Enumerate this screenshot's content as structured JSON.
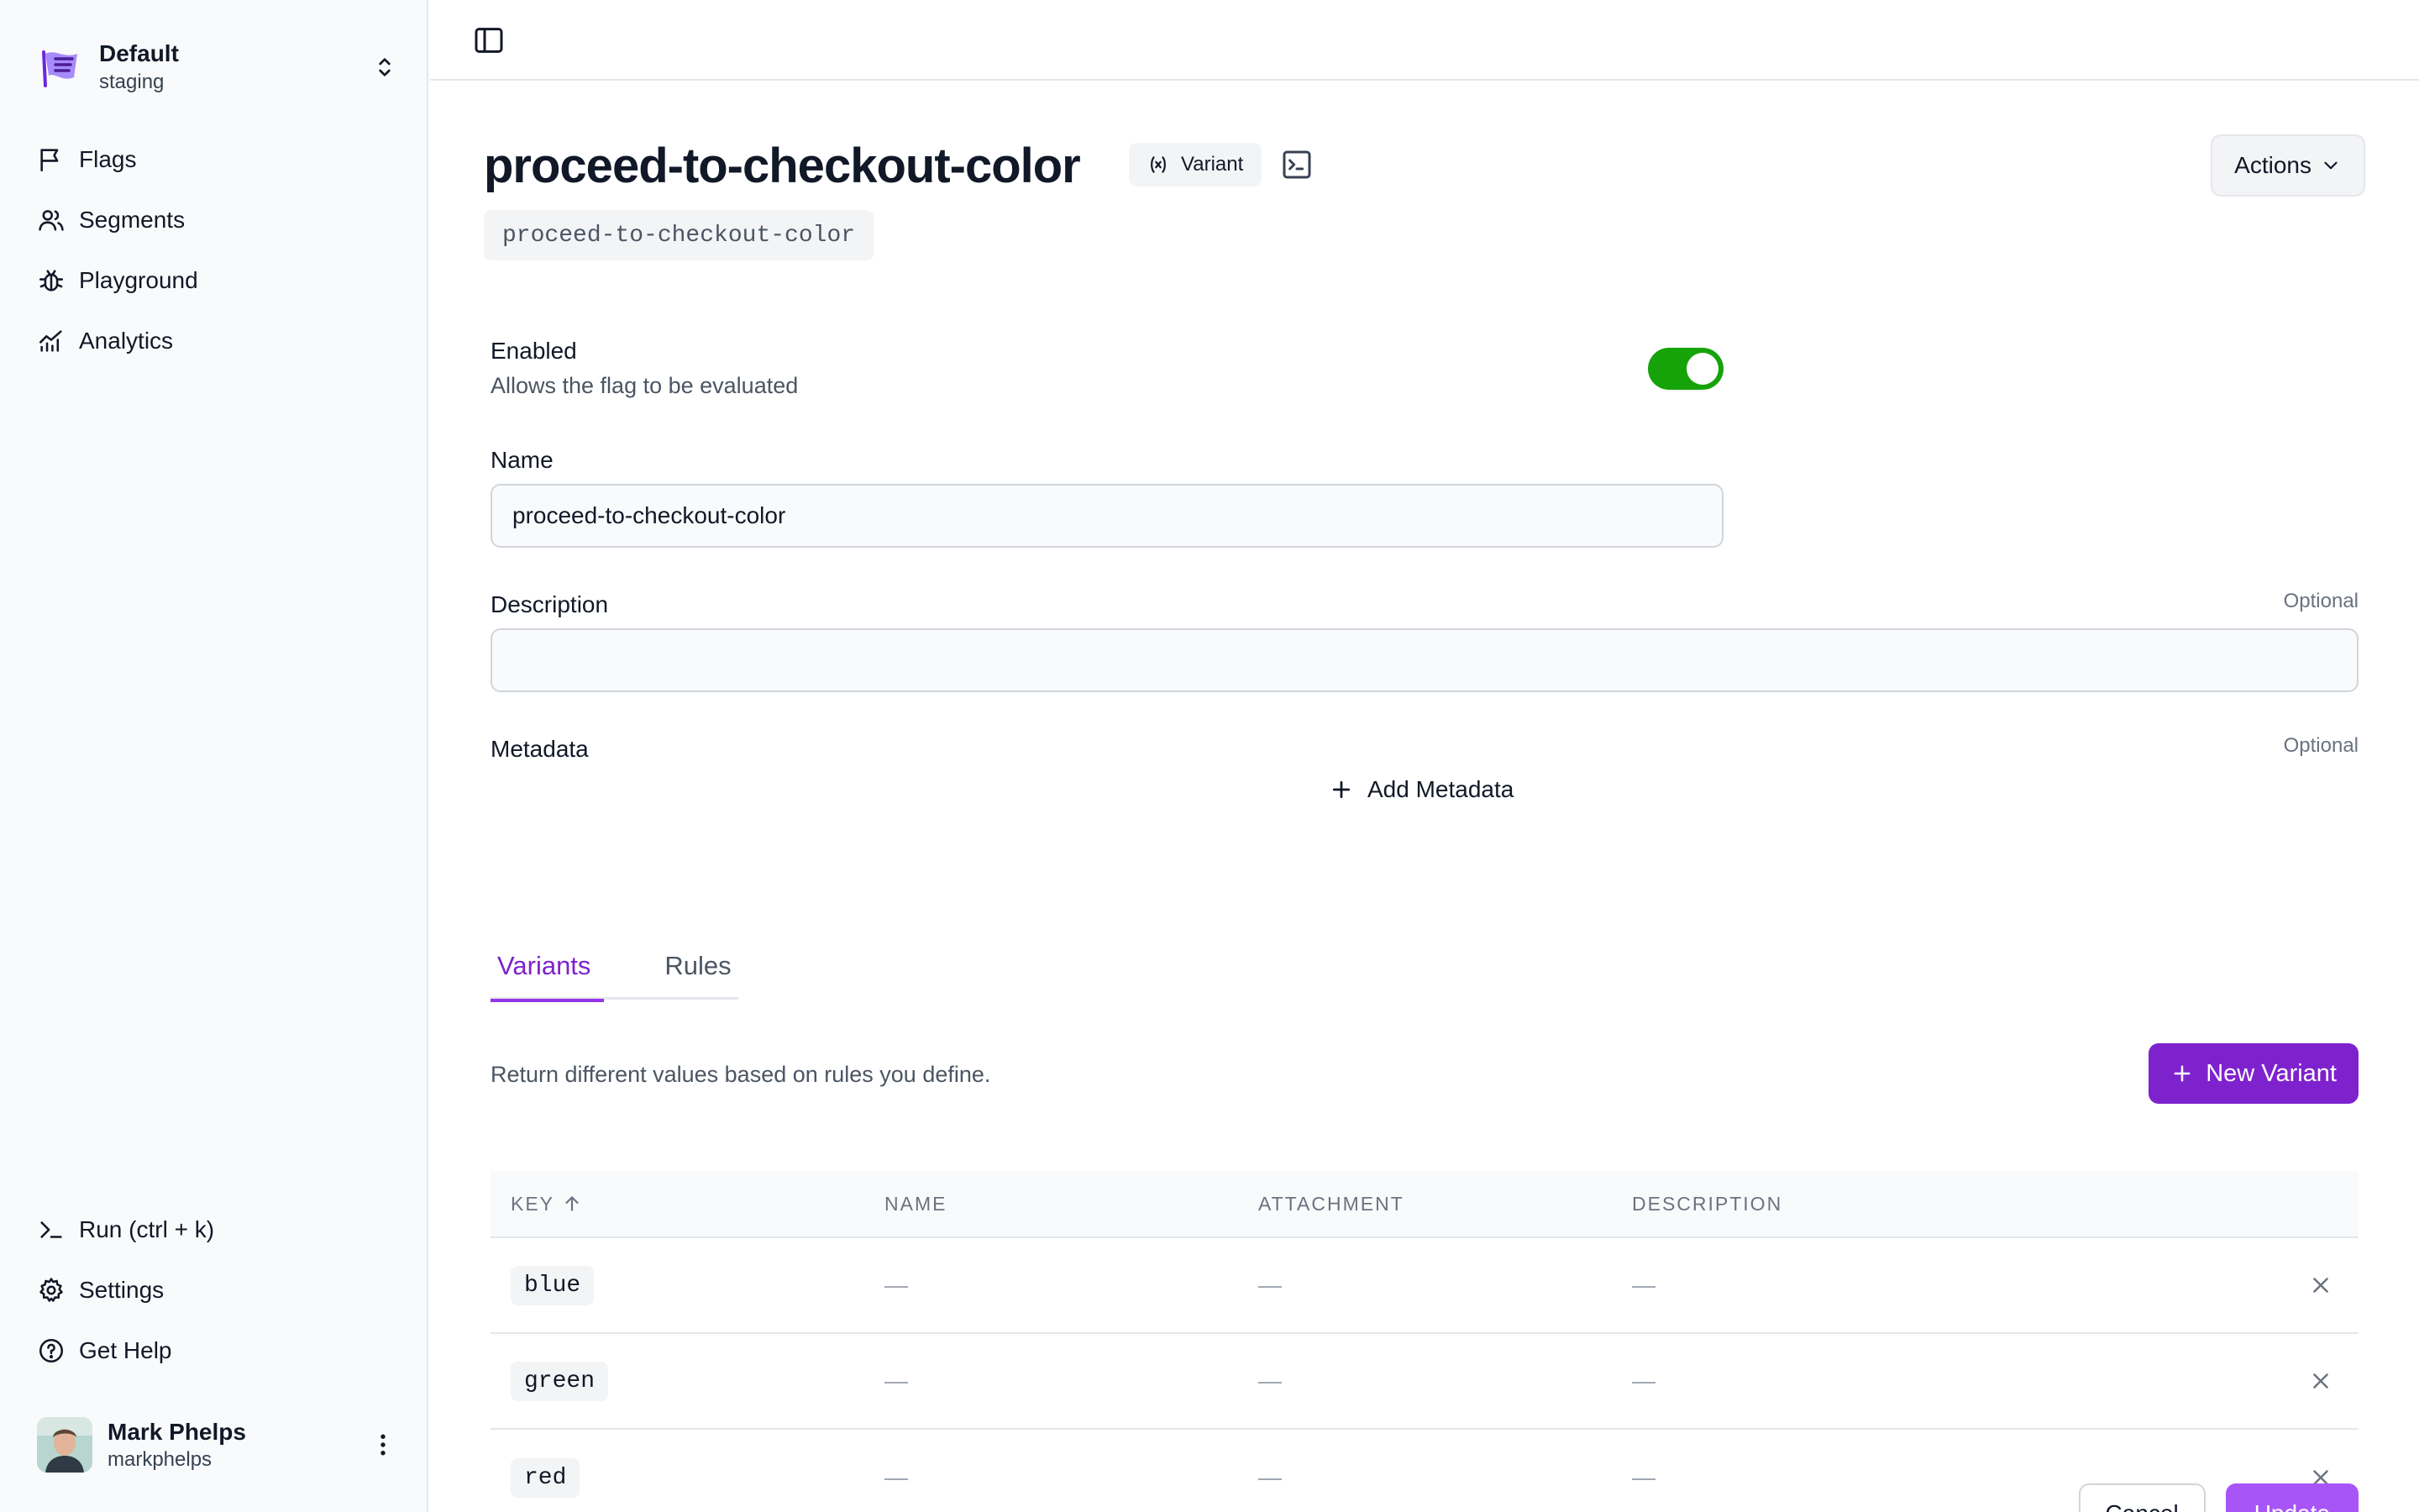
{
  "namespace": {
    "name": "Default",
    "environment": "staging"
  },
  "sidebar": {
    "items": [
      {
        "label": "Flags",
        "icon": "flag-icon"
      },
      {
        "label": "Segments",
        "icon": "users-icon"
      },
      {
        "label": "Playground",
        "icon": "bug-icon"
      },
      {
        "label": "Analytics",
        "icon": "chart-icon"
      }
    ],
    "bottom_items": [
      {
        "label": "Run (ctrl + k)",
        "icon": "terminal-icon"
      },
      {
        "label": "Settings",
        "icon": "gear-icon"
      },
      {
        "label": "Get Help",
        "icon": "help-icon"
      }
    ],
    "user": {
      "name": "Mark Phelps",
      "handle": "markphelps"
    }
  },
  "flag": {
    "title": "proceed-to-checkout-color",
    "type_badge": "Variant",
    "key": "proceed-to-checkout-color",
    "actions_label": "Actions"
  },
  "form": {
    "enabled_label": "Enabled",
    "enabled_help": "Allows the flag to be evaluated",
    "enabled": true,
    "name_label": "Name",
    "name_value": "proceed-to-checkout-color",
    "description_label": "Description",
    "description_optional": "Optional",
    "description_value": "",
    "metadata_label": "Metadata",
    "metadata_optional": "Optional",
    "add_metadata_label": "Add Metadata"
  },
  "tabs": [
    {
      "label": "Variants",
      "active": true
    },
    {
      "label": "Rules",
      "active": false
    }
  ],
  "variants": {
    "description": "Return different values based on rules you define.",
    "new_button": "New Variant",
    "columns": [
      "KEY",
      "NAME",
      "ATTACHMENT",
      "DESCRIPTION"
    ],
    "rows": [
      {
        "key": "blue",
        "name": "—",
        "attachment": "—",
        "description": "—"
      },
      {
        "key": "green",
        "name": "—",
        "attachment": "—",
        "description": "—"
      },
      {
        "key": "red",
        "name": "—",
        "attachment": "—",
        "description": "—"
      }
    ]
  },
  "footer": {
    "cancel_label": "Cancel",
    "update_label": "Update"
  },
  "colors": {
    "accent": "#7e22ce",
    "toggle_on": "#16a30a"
  }
}
